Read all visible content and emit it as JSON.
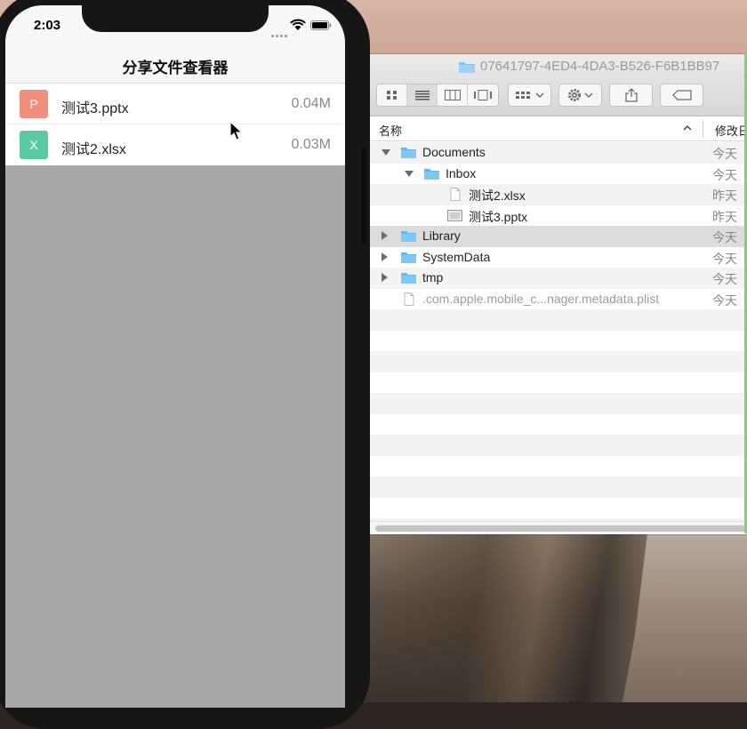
{
  "phone": {
    "status": {
      "time": "2:03"
    },
    "nav_title": "分享文件查看器",
    "files": [
      {
        "badge": "P",
        "name": "测试3.pptx",
        "size": "0.04M",
        "color": "#ef8f7e"
      },
      {
        "badge": "X",
        "name": "测试2.xlsx",
        "size": "0.03M",
        "color": "#5bc9a3"
      }
    ]
  },
  "finder": {
    "title": "07641797-4ED4-4DA3-B526-F6B1BB97",
    "columns": {
      "name": "名称",
      "modified": "修改日"
    },
    "rows": [
      {
        "name": "Documents",
        "date": "今天",
        "type": "folder",
        "level": 0,
        "disclosure": "open"
      },
      {
        "name": "Inbox",
        "date": "今天",
        "type": "folder",
        "level": 1,
        "disclosure": "open"
      },
      {
        "name": "测试2.xlsx",
        "date": "昨天",
        "type": "doc",
        "level": 2,
        "disclosure": "none"
      },
      {
        "name": "测试3.pptx",
        "date": "昨天",
        "type": "ppt",
        "level": 2,
        "disclosure": "none"
      },
      {
        "name": "Library",
        "date": "今天",
        "type": "folder",
        "level": 0,
        "disclosure": "closed",
        "selected": true
      },
      {
        "name": "SystemData",
        "date": "今天",
        "type": "folder",
        "level": 0,
        "disclosure": "closed"
      },
      {
        "name": "tmp",
        "date": "今天",
        "type": "folder",
        "level": 0,
        "disclosure": "closed"
      },
      {
        "name": ".com.apple.mobile_c...nager.metadata.plist",
        "date": "今天",
        "type": "doc",
        "level": 0,
        "disclosure": "none",
        "dim": true
      }
    ]
  },
  "colors": {
    "folder": "#5fb8f0",
    "accent_green": "#7ed36b"
  }
}
